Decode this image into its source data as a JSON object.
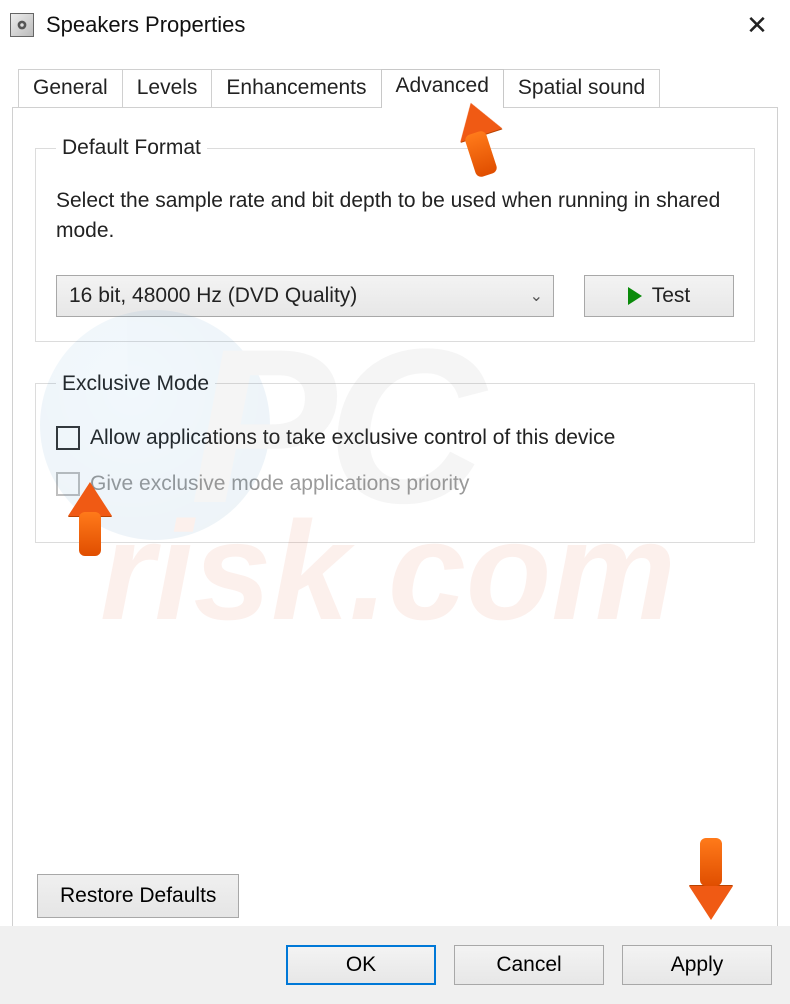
{
  "window": {
    "title": "Speakers Properties"
  },
  "tabs": {
    "general": "General",
    "levels": "Levels",
    "enhancements": "Enhancements",
    "advanced": "Advanced",
    "spatial": "Spatial sound",
    "active": "advanced"
  },
  "default_format": {
    "legend": "Default Format",
    "description": "Select the sample rate and bit depth to be used when running in shared mode.",
    "selected": "16 bit, 48000 Hz (DVD Quality)",
    "test_label": "Test"
  },
  "exclusive_mode": {
    "legend": "Exclusive Mode",
    "allow_label": "Allow applications to take exclusive control of this device",
    "allow_checked": false,
    "priority_label": "Give exclusive mode applications priority",
    "priority_enabled": false
  },
  "restore_label": "Restore Defaults",
  "footer": {
    "ok": "OK",
    "cancel": "Cancel",
    "apply": "Apply"
  },
  "watermark": {
    "line1": "PC",
    "line2": "risk.com"
  }
}
